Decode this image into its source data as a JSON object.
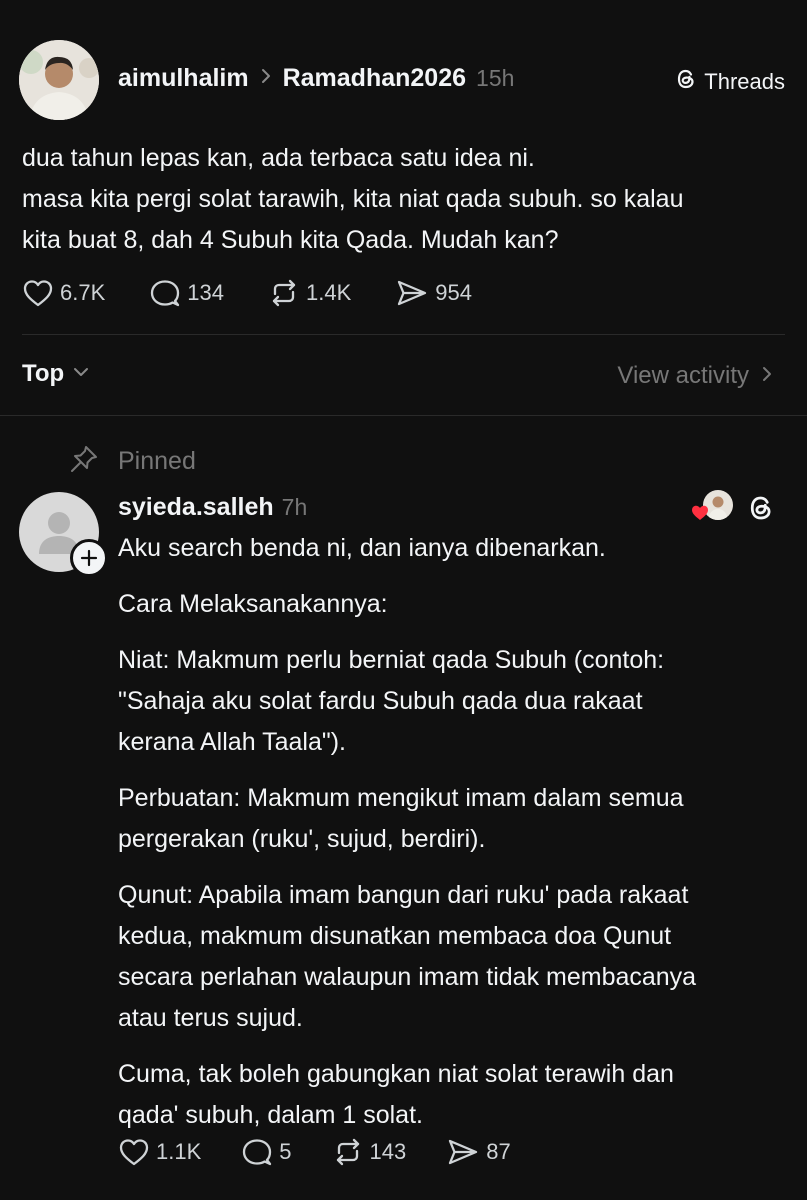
{
  "post": {
    "author": "aimulhalim",
    "topic": "Ramadhan2026",
    "time": "15h",
    "app_badge": "Threads",
    "lines": [
      "dua tahun lepas kan, ada terbaca satu idea ni.",
      "masa kita pergi solat tarawih, kita niat qada subuh. so kalau",
      "kita buat 8, dah 4 Subuh kita Qada. Mudah kan?"
    ],
    "likes": "6.7K",
    "replies": "134",
    "reposts": "1.4K",
    "shares": "954"
  },
  "sort": {
    "label": "Top",
    "view_activity": "View activity"
  },
  "reply": {
    "pinned_label": "Pinned",
    "author": "syieda.salleh",
    "time": "7h",
    "paragraphs": [
      [
        "Aku search benda ni, dan ianya dibenarkan."
      ],
      [
        "Cara Melaksanakannya:"
      ],
      [
        "Niat: Makmum perlu berniat qada Subuh (contoh:",
        "\"Sahaja aku solat fardu Subuh qada dua rakaat",
        "kerana Allah Taala\")."
      ],
      [
        "Perbuatan: Makmum mengikut imam dalam semua",
        "pergerakan (ruku', sujud, berdiri)."
      ],
      [
        "Qunut: Apabila imam bangun dari ruku' pada rakaat",
        "kedua, makmum disunatkan membaca doa Qunut",
        "secara perlahan walaupun imam tidak membacanya",
        "atau terus sujud."
      ],
      [
        "Cuma, tak boleh gabungkan niat solat terawih dan",
        "qada' subuh, dalam 1 solat."
      ]
    ],
    "likes": "1.1K",
    "replies": "5",
    "reposts": "143",
    "shares": "87"
  },
  "colors": {
    "background": "#101010",
    "text": "#f3f5f7",
    "muted": "#777777",
    "heart": "#ff3040"
  }
}
